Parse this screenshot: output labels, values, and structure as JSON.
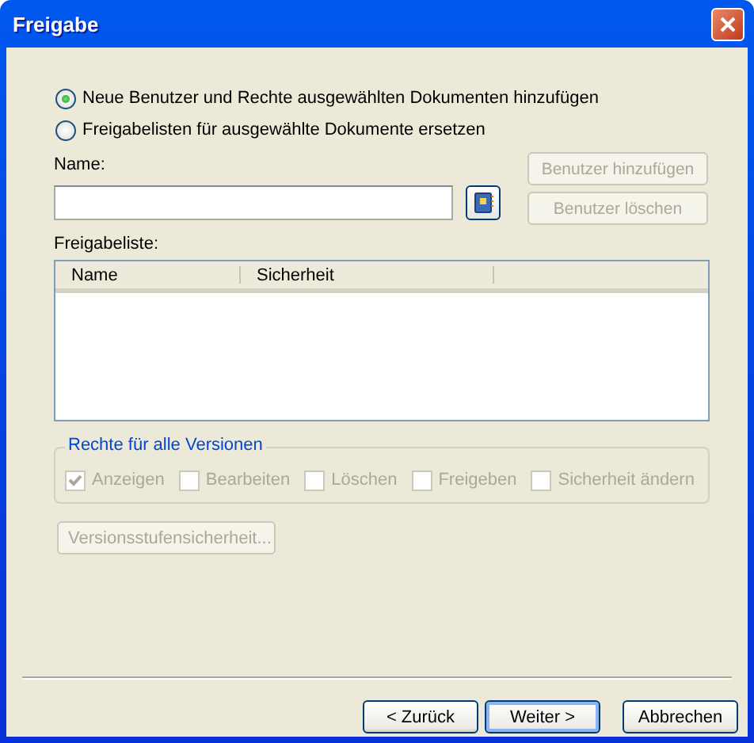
{
  "window": {
    "title": "Freigabe"
  },
  "options": [
    {
      "label": "Neue Benutzer und Rechte ausgewählten Dokumenten hinzufügen",
      "selected": true
    },
    {
      "label": "Freigabelisten für ausgewählte Dokumente ersetzen",
      "selected": false
    }
  ],
  "name_field": {
    "label": "Name:"
  },
  "side_buttons": [
    {
      "label": "Benutzer hinzufügen",
      "disabled": true
    },
    {
      "label": "Benutzer löschen",
      "disabled": true
    }
  ],
  "share_list": {
    "label": "Freigabeliste:",
    "columns": [
      "Name",
      "Sicherheit"
    ]
  },
  "rights": {
    "title": "Rechte für alle Versionen",
    "items": [
      {
        "label": "Anzeigen",
        "checked": true,
        "disabled": true
      },
      {
        "label": "Bearbeiten",
        "checked": false,
        "disabled": true
      },
      {
        "label": "Löschen",
        "checked": false,
        "disabled": true
      },
      {
        "label": "Freigeben",
        "checked": false,
        "disabled": true
      },
      {
        "label": "Sicherheit ändern",
        "checked": false,
        "disabled": true
      }
    ]
  },
  "version_button": {
    "label": "Versionsstufensicherheit...",
    "disabled": true
  },
  "footer_buttons": [
    {
      "label": "< Zurück",
      "default": false
    },
    {
      "label": "Weiter >",
      "default": true
    },
    {
      "label": "Abbrechen",
      "default": false
    }
  ]
}
